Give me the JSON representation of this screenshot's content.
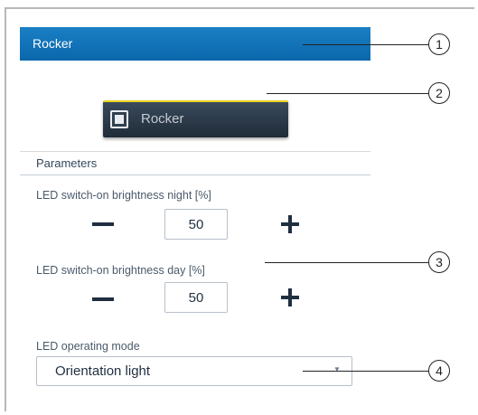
{
  "header": {
    "title": "Rocker"
  },
  "rocker_button": {
    "label": "Rocker",
    "icon": "rocker-square-icon",
    "accent": "#e8d21d"
  },
  "parameters": {
    "section_title": "Parameters",
    "night": {
      "label": "LED switch-on brightness night [%]",
      "value": "50"
    },
    "day": {
      "label": "LED switch-on brightness day [%]",
      "value": "50"
    },
    "mode": {
      "label": "LED operating mode",
      "value": "Orientation light"
    }
  },
  "callouts": [
    "1",
    "2",
    "3",
    "4"
  ],
  "colors": {
    "title_bar": "#0b67ac",
    "button_bg": "#1f2b38"
  }
}
